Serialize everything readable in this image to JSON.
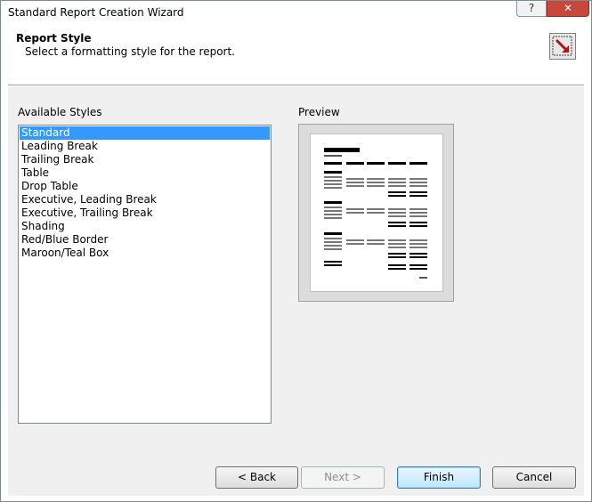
{
  "window": {
    "title": "Standard Report Creation Wizard",
    "help_label": "?",
    "close_label": "✕"
  },
  "header": {
    "title": "Report Style",
    "subtitle": "Select a formatting style for the report."
  },
  "styles": {
    "label": "Available Styles",
    "items": [
      "Standard",
      "Leading Break",
      "Trailing Break",
      "Table",
      "Drop Table",
      "Executive, Leading Break",
      "Executive, Trailing Break",
      "Shading",
      "Red/Blue Border",
      "Maroon/Teal Box"
    ],
    "selected": "Standard"
  },
  "preview": {
    "label": "Preview"
  },
  "buttons": {
    "back": "< Back",
    "next": "Next >",
    "finish": "Finish",
    "cancel": "Cancel"
  },
  "colors": {
    "selection": "#3399ff",
    "close_button": "#c7473b"
  }
}
